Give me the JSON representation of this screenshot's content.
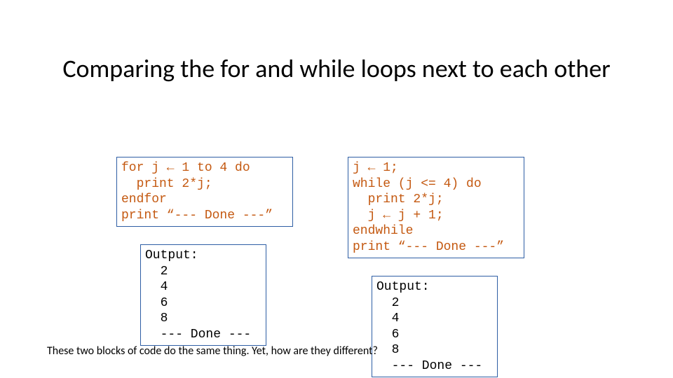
{
  "title": "Comparing the for and while loops next to each\nother",
  "left": {
    "code": "for j ← 1 to 4 do\n  print 2*j;\nendfor\nprint “--- Done ---”",
    "output": "Output:\n  2\n  4\n  6\n  8\n  --- Done ---"
  },
  "right": {
    "code": "j ← 1;\nwhile (j <= 4) do\n  print 2*j;\n  j ← j + 1;\nendwhile\nprint “--- Done ---”",
    "output": "Output:\n  2\n  4\n  6\n  8\n  --- Done ---"
  },
  "caption": "These two blocks of code do the same thing.\nYet, how are they different?"
}
